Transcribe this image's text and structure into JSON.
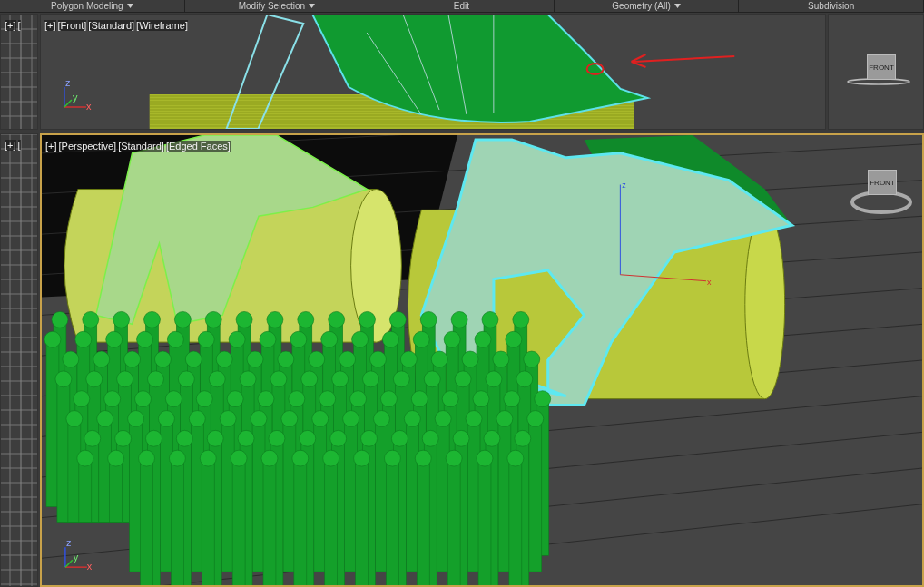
{
  "ribbon": [
    {
      "label": "Polygon Modeling",
      "dropdown": true
    },
    {
      "label": "Modify Selection",
      "dropdown": true
    },
    {
      "label": "Edit",
      "dropdown": false
    },
    {
      "label": "Geometry (All)",
      "dropdown": true
    },
    {
      "label": "Subdivision",
      "dropdown": false
    }
  ],
  "top_row": {
    "left": {
      "labels": [
        "[+]",
        "["
      ]
    },
    "front": {
      "labels": [
        "[+]",
        "[Front]",
        "[Standard]",
        "[Wireframe]"
      ],
      "selected": false,
      "axes": [
        "z",
        "y",
        "x"
      ]
    },
    "right": {
      "viewcube": "FRONT"
    }
  },
  "bottom_row": {
    "left": {
      "labels": [
        "[+]",
        "["
      ]
    },
    "perspective": {
      "labels": [
        "[+]",
        "[Perspective]",
        "[Standard]",
        "[Edged Faces]"
      ],
      "selected": true,
      "viewcube": "FRONT",
      "gizmo": [
        "z",
        "x"
      ],
      "axes": [
        "z",
        "y",
        "x"
      ]
    }
  }
}
